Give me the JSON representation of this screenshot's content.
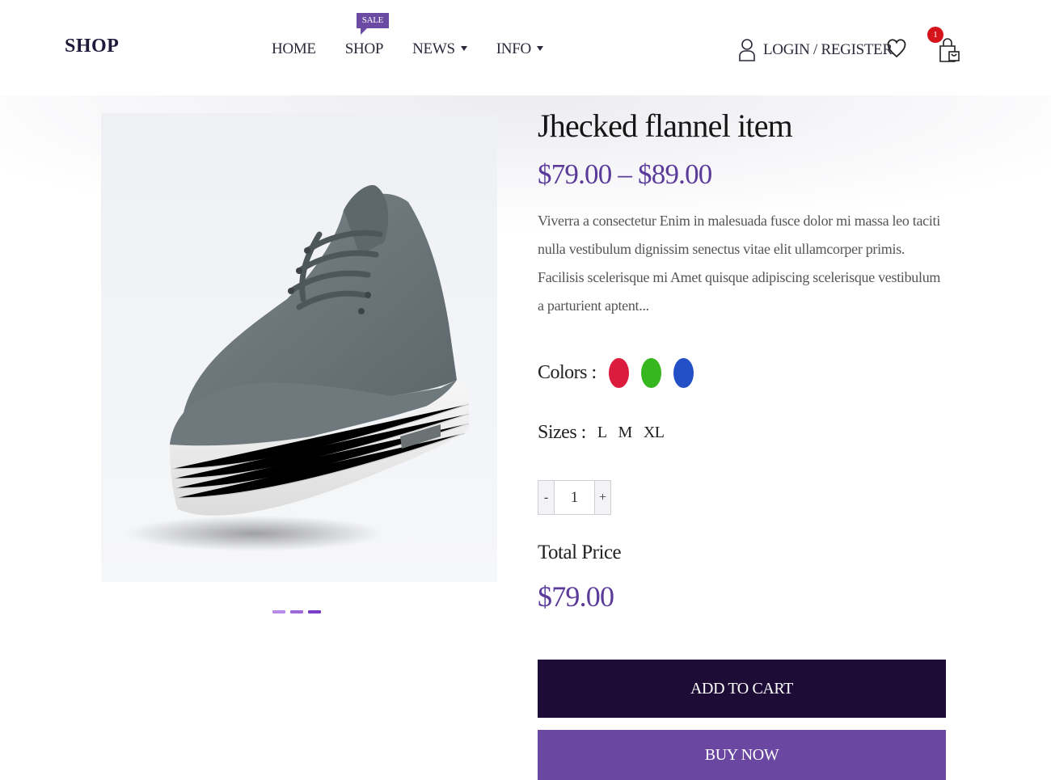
{
  "header": {
    "logo": "SHOP",
    "nav": [
      {
        "label": "HOME",
        "dropdown": false
      },
      {
        "label": "SHOP",
        "dropdown": false,
        "badge": "SALE"
      },
      {
        "label": "NEWS",
        "dropdown": true
      },
      {
        "label": "INFO",
        "dropdown": true
      }
    ],
    "login_label": "LOGIN / REGISTER",
    "cart_count": "1",
    "icons": [
      "user-icon",
      "heart-icon",
      "shopping-bag-icon"
    ]
  },
  "product": {
    "title": "Jhecked flannel item",
    "price_range": "$79.00 – $89.00",
    "description": "Viverra a consectetur Enim in malesuada fusce dolor mi massa leo taciti nulla vestibulum dignissim senectus vitae elit ullamcorper primis. Facilisis scelerisque mi Amet quisque adipiscing scelerisque vestibulum a parturient aptent...",
    "colors_label": "Colors :",
    "colors": [
      "#dc1c3c",
      "#36b71f",
      "#2450c6"
    ],
    "sizes_label": "Sizes :",
    "sizes": [
      "L",
      "M",
      "XL"
    ],
    "quantity": {
      "minus": "-",
      "value": "1",
      "plus": "+"
    },
    "total_label": "Total Price",
    "total_value": "$79.00",
    "add_to_cart": "ADD TO CART",
    "buy_now": "BUY NOW",
    "gallery_dot_colors": [
      "#b58be6",
      "#9d6ad8",
      "#7a3fc9"
    ]
  },
  "brand_colors": {
    "accent": "#5a3b99",
    "dark": "#1d0d36",
    "button": "#6a48a1",
    "badge": "#d4131b"
  }
}
